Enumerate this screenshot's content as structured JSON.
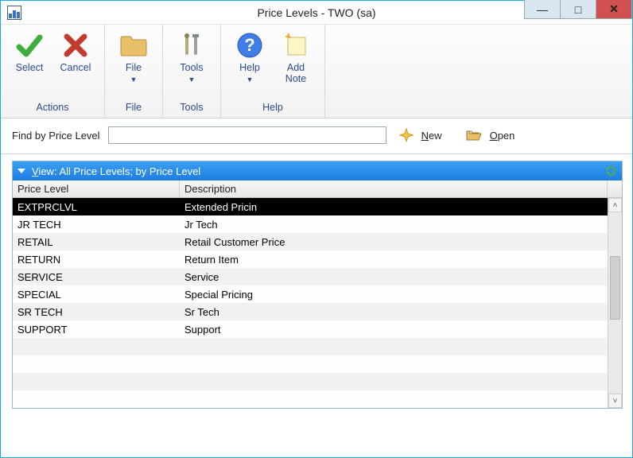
{
  "window": {
    "title": "Price Levels  -  TWO (sa)"
  },
  "toolbar": {
    "groups": {
      "actions": {
        "caption": "Actions",
        "select": "Select",
        "cancel": "Cancel"
      },
      "file": {
        "caption": "File",
        "file": "File"
      },
      "tools": {
        "caption": "Tools",
        "tools": "Tools"
      },
      "help": {
        "caption": "Help",
        "help": "Help",
        "addnote": "Add\nNote"
      }
    }
  },
  "findbar": {
    "label": "Find by Price Level",
    "value": "",
    "new": "New",
    "newU": "N",
    "open": "Open",
    "openU": "O"
  },
  "view": {
    "label_u": "V",
    "label_rest": "iew: All Price Levels; by Price Level"
  },
  "columns": {
    "price_level": "Price Level",
    "description": "Description"
  },
  "rows": [
    {
      "price_level": "EXTPRCLVL",
      "description": "Extended Pricin",
      "selected": true
    },
    {
      "price_level": "JR TECH",
      "description": "Jr Tech"
    },
    {
      "price_level": "RETAIL",
      "description": "Retail Customer Price"
    },
    {
      "price_level": "RETURN",
      "description": "Return Item"
    },
    {
      "price_level": "SERVICE",
      "description": "Service"
    },
    {
      "price_level": "SPECIAL",
      "description": "Special Pricing"
    },
    {
      "price_level": "SR TECH",
      "description": "Sr Tech"
    },
    {
      "price_level": "SUPPORT",
      "description": "Support"
    }
  ]
}
